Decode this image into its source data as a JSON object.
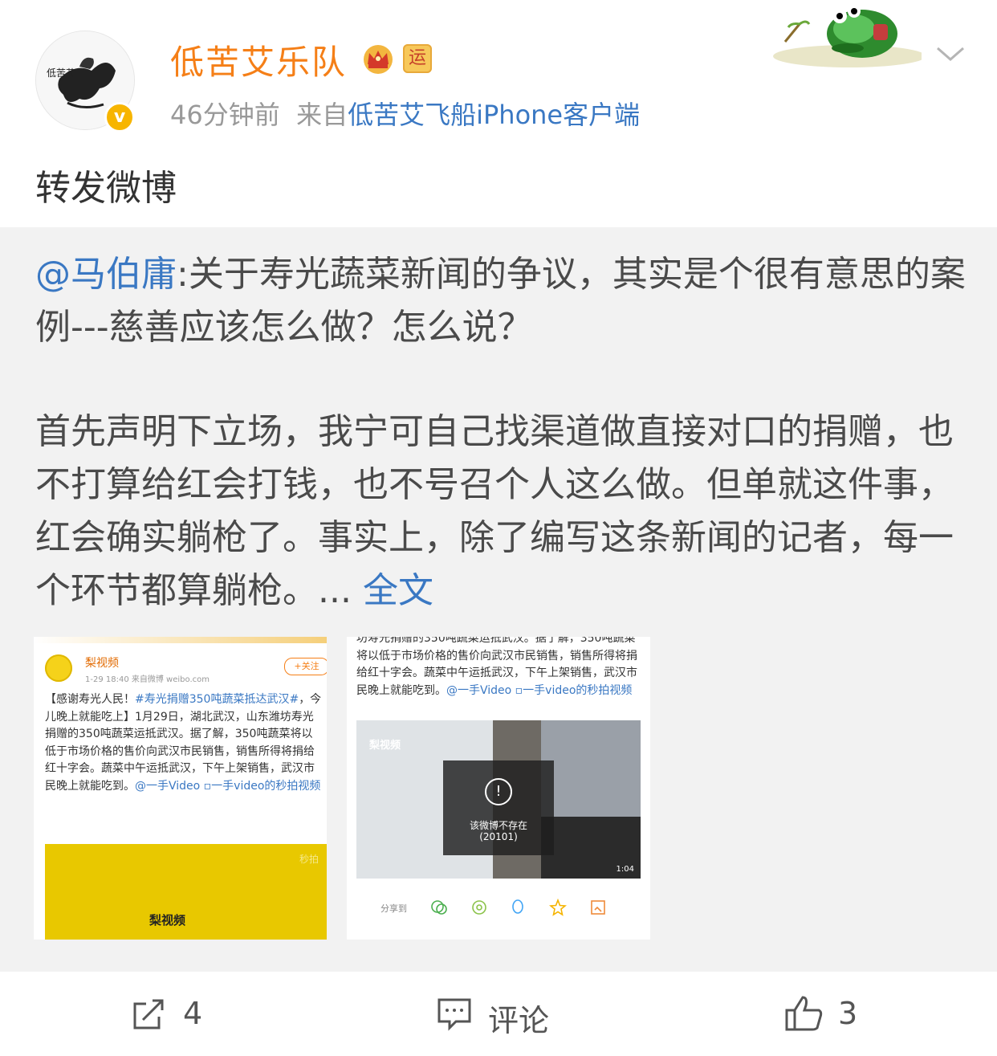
{
  "author": {
    "username": "低苦艾乐队",
    "badge_yun": "运",
    "time": "46分钟前",
    "source_prefix": "来自",
    "source": "低苦艾飞船iPhone客户端",
    "avatar_text": "低苦艾"
  },
  "post": {
    "text": "转发微博"
  },
  "repost": {
    "mention": "@马伯庸",
    "line1": ":关于寿光蔬菜新闻的争议，其实是个很有意思的案例---慈善应该怎么做？怎么说？",
    "para2": "首先声明下立场，我宁可自己找渠道做直接对口的捐赠，也不打算给红会打钱，也不号召个人这么做。但单就这件事，红会确实躺枪了。事实上，除了编写这条新闻的记者，每一个环节都算躺枪。...",
    "more": "全文"
  },
  "thumb1": {
    "name": "梨视频",
    "time": "1-29 18:40 来自微博 weibo.com",
    "follow": "+关注",
    "text_a": "【感谢寿光人民！",
    "hashtag": "#寿光捐赠350吨蔬菜抵达武汉#",
    "text_b": "，今儿晚上就能吃上",
    "text_c": "】1月29日，湖北武汉，山东潍坊寿光捐赠的350吨蔬菜运抵武汉。据了解，350吨蔬菜将以低于市场价格的售价向武汉市民销售，销售所得将捐给红十字会。蔬菜中午运抵武汉，下午上架销售，武汉市民晚上就能吃到。",
    "link": "@一手Video ▫一手video的秒拍视频",
    "miaopai": "秒拍",
    "pear_label": "梨视频"
  },
  "thumb2": {
    "text_top": "坊寿光捐赠的350吨蔬菜运抵武汉。据了解，350吨蔬菜将以低于市场价格的售价向武汉市民销售，销售所得将捐给红十字会。蔬菜中午运抵武汉，下午上架销售，武汉市民晚上就能吃到。",
    "link": "@一手Video ▫一手video的秒拍视频",
    "pear_label": "梨视频",
    "error_msg": "该微博不存在",
    "error_code": "(20101)",
    "duration": "1:04",
    "share_label": "分享到"
  },
  "footer": {
    "repost_count": "4",
    "comment_label": "评论",
    "like_count": "3"
  },
  "colors": {
    "username": "#f57f17",
    "link": "#3a78c3",
    "repost_bg": "#f2f2f2"
  }
}
